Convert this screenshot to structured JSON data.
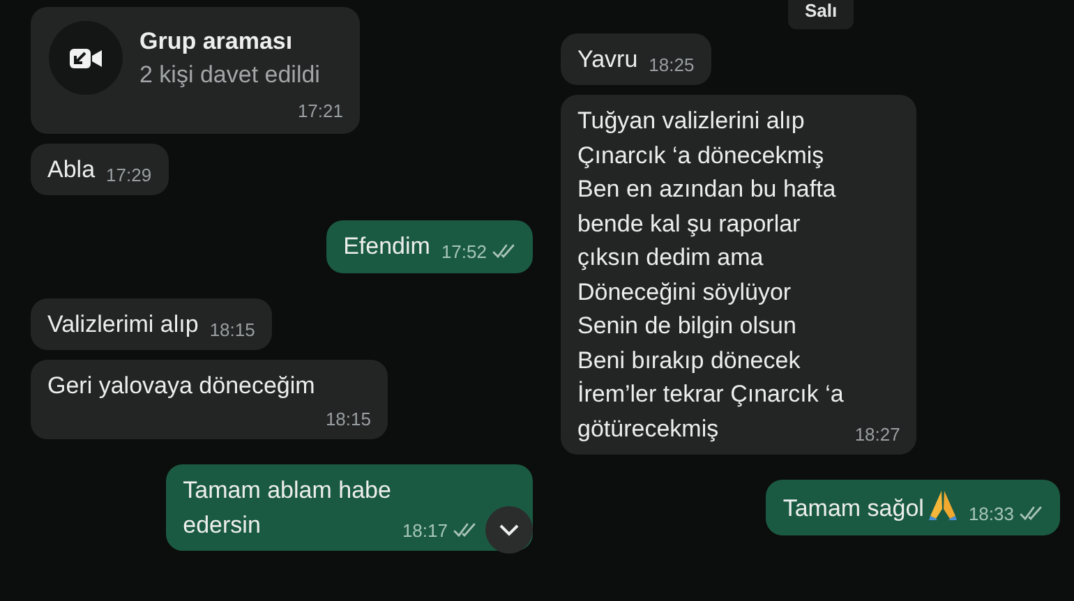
{
  "left_panel": {
    "messages": [
      {
        "kind": "call",
        "title": "Grup araması",
        "subtitle": "2 kişi davet edildi",
        "time": "17:21"
      },
      {
        "kind": "incoming",
        "lines": [
          "Abla"
        ],
        "time": "17:29"
      },
      {
        "kind": "outgoing",
        "lines": [
          "Efendim"
        ],
        "time": "17:52",
        "delivered": true
      },
      {
        "kind": "incoming",
        "lines": [
          "Valizlerimi alıp"
        ],
        "time": "18:15"
      },
      {
        "kind": "incoming",
        "lines": [
          "Geri yalovaya döneceğim"
        ],
        "time": "18:15"
      },
      {
        "kind": "outgoing",
        "lines": [
          "Tamam ablam habe",
          "edersin"
        ],
        "time": "18:17",
        "delivered": true
      }
    ],
    "scroll_down_button": true
  },
  "right_panel": {
    "date_chip": "Salı",
    "messages": [
      {
        "kind": "incoming",
        "lines": [
          "Yavru"
        ],
        "time": "18:25"
      },
      {
        "kind": "incoming",
        "lines": [
          "Tuğyan valizlerini alıp",
          "Çınarcık ‘a dönecekmiş",
          "Ben en azından bu hafta",
          "bende kal şu raporlar",
          "çıksın dedim ama",
          "Döneceğini söylüyor",
          "Senin de bilgin olsun",
          "Beni bırakıp dönecek",
          "İrem’ler tekrar Çınarcık ‘a",
          "götürecekmiş"
        ],
        "time": "18:27"
      },
      {
        "kind": "outgoing",
        "lines": [
          "Tamam sağol"
        ],
        "praying_hands": true,
        "time": "18:33",
        "delivered": true
      }
    ]
  }
}
